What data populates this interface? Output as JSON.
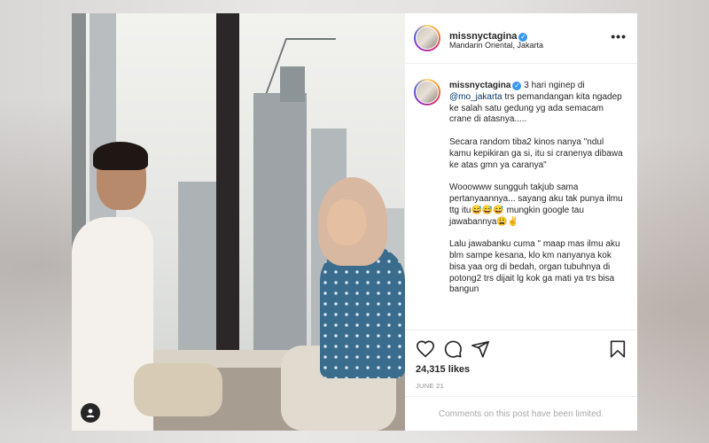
{
  "post": {
    "username": "missnyctagina",
    "location": "Mandarin Oriental, Jakarta",
    "more_label": "•••",
    "verified_glyph": "✓",
    "caption_username": "missnyctagina",
    "caption_line1": "3 hari nginep di",
    "mention": "@mo_jakarta",
    "caption_body": " trs pemandangan kita ngadep ke salah satu gedung yg ada semacam crane di atasnya.....\n\nSecara random tiba2 kinos nanya \"ndul kamu kepikiran ga si, itu si cranenya dibawa ke atas gmn ya caranya\"\n\nWooowww sungguh takjub sama pertanyaannya... sayang aku tak punya ilmu ttg itu😅😅😅 mungkin google tau jawabannya😩✌\n\nLalu jawabanku cuma \" maap mas ilmu aku blm sampe kesana, klo km nanyanya kok bisa yaa org di bedah, organ tubuhnya di potong2 trs dijait lg kok ga mati ya trs bisa bangun",
    "likes": "24,315 likes",
    "date": "JUNE 21",
    "comments_limited": "Comments on this post have been limited.",
    "user_tag_glyph": "👤"
  },
  "icons": {
    "like": "heart-icon",
    "comment": "comment-icon",
    "share": "share-icon",
    "save": "bookmark-icon",
    "more": "more-icon",
    "tag": "user-tag-icon"
  },
  "colors": {
    "verified": "#3897f0",
    "text": "#262626",
    "muted": "#8e8e8e",
    "mention": "#00376b"
  }
}
